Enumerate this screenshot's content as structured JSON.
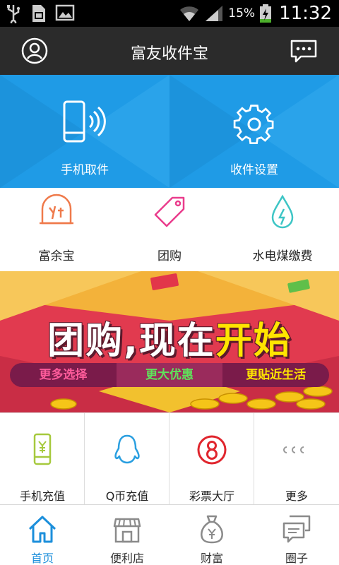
{
  "status_bar": {
    "battery_percent": "15%",
    "time": "11:32",
    "icons": [
      "usb-icon",
      "sd-card-icon",
      "image-icon",
      "wifi-icon",
      "signal-icon",
      "battery-charging-icon"
    ]
  },
  "header": {
    "title": "富友收件宝",
    "left_icon": "user-icon",
    "right_icon": "message-icon"
  },
  "hero": {
    "tiles": [
      {
        "label": "手机取件",
        "icon": "phone-nfc-icon"
      },
      {
        "label": "收件设置",
        "icon": "gear-icon"
      }
    ],
    "background": "#1f9be6"
  },
  "services": [
    {
      "label": "富余宝",
      "icon": "coin-bag-icon",
      "color": "#ef7a4b"
    },
    {
      "label": "团购",
      "icon": "tag-icon",
      "color": "#ea3c8c"
    },
    {
      "label": "水电煤缴费",
      "icon": "water-drop-icon",
      "color": "#3dc5c5"
    }
  ],
  "banner": {
    "headline_part1": "团购,现在",
    "headline_part2": "开始",
    "segments": [
      "更多选择",
      "更大优惠",
      "更贴近生活"
    ]
  },
  "quick_grid": [
    {
      "label": "手机充值",
      "icon": "mobile-topup-icon",
      "color": "#a6c93d"
    },
    {
      "label": "Q币充值",
      "icon": "qq-penguin-icon",
      "color": "#2a9fe0"
    },
    {
      "label": "彩票大厅",
      "icon": "lottery-ball-icon",
      "color": "#e0262e"
    },
    {
      "label": "更多",
      "icon": "more-dots-icon",
      "color": "#9a9a9a"
    }
  ],
  "bottom_nav": {
    "active_index": 0,
    "accent": "#1c8fdb",
    "tabs": [
      {
        "label": "首页",
        "icon": "home-icon"
      },
      {
        "label": "便利店",
        "icon": "store-icon"
      },
      {
        "label": "财富",
        "icon": "money-bag-icon"
      },
      {
        "label": "圈子",
        "icon": "chat-bubbles-icon"
      }
    ]
  }
}
